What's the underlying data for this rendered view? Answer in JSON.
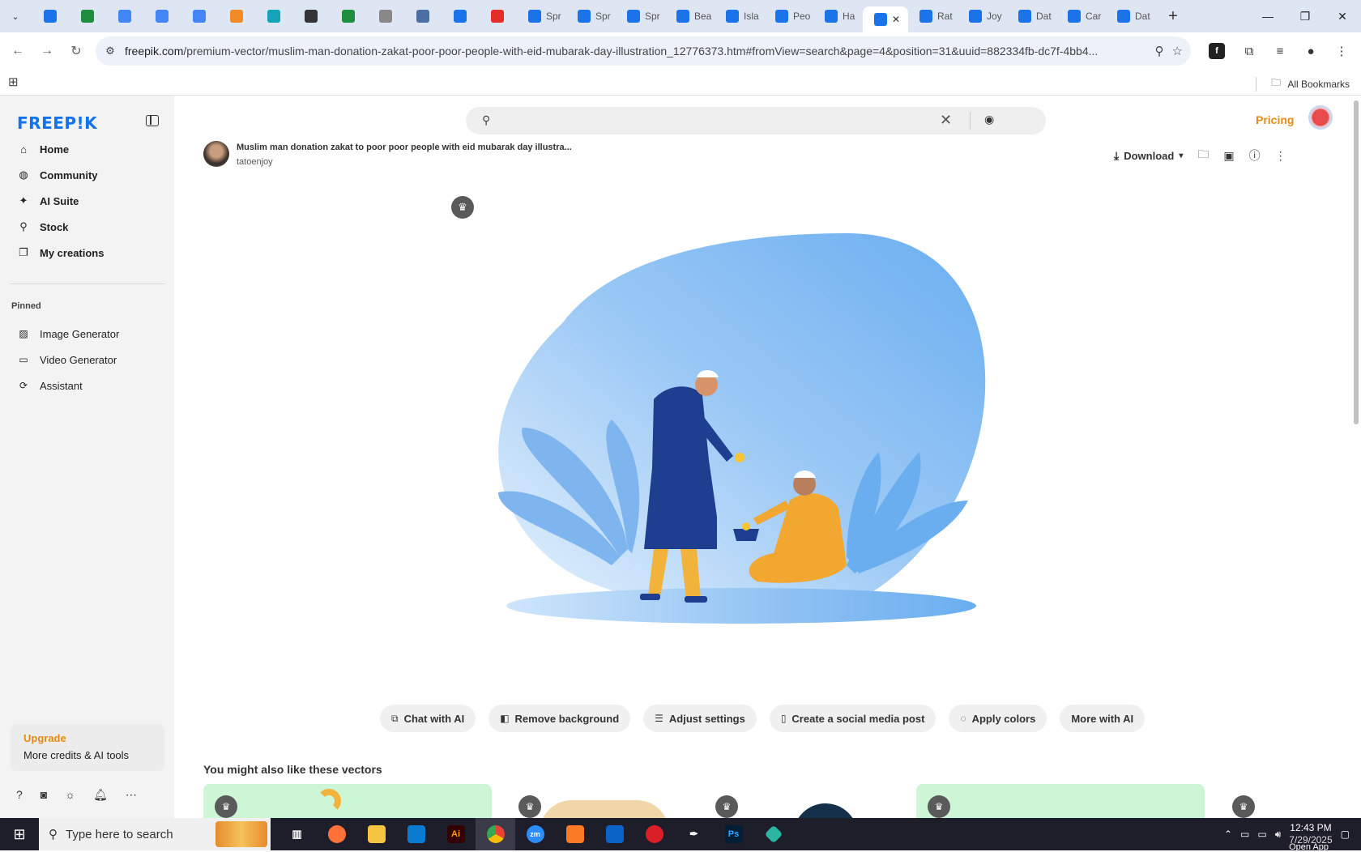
{
  "browser": {
    "tabs": [
      {
        "label": "",
        "color": "#1a73e8"
      },
      {
        "label": "",
        "color": "#1e8e3e"
      },
      {
        "label": "",
        "color": "#4285f4"
      },
      {
        "label": "",
        "color": "#4285f4"
      },
      {
        "label": "",
        "color": "#4285f4"
      },
      {
        "label": "",
        "color": "#f28b25"
      },
      {
        "label": "",
        "color": "#14a3b8"
      },
      {
        "label": "",
        "color": "#333333"
      },
      {
        "label": "",
        "color": "#1e8e3e"
      },
      {
        "label": "",
        "color": "#888888"
      },
      {
        "label": "",
        "color": "#4a6fa5"
      },
      {
        "label": "",
        "color": "#1a73e8"
      },
      {
        "label": "",
        "color": "#e52d27"
      },
      {
        "label": "Spr",
        "color": "#1a73e8"
      },
      {
        "label": "Spr",
        "color": "#1a73e8"
      },
      {
        "label": "Spr",
        "color": "#1a73e8"
      },
      {
        "label": "Bea",
        "color": "#1a73e8"
      },
      {
        "label": "Isla",
        "color": "#1a73e8"
      },
      {
        "label": "Peo",
        "color": "#1a73e8"
      },
      {
        "label": "Ha",
        "color": "#1a73e8"
      }
    ],
    "active_tab_close": "✕",
    "after_tabs": [
      {
        "label": "Rat",
        "color": "#1a73e8"
      },
      {
        "label": "Joy",
        "color": "#1a73e8"
      },
      {
        "label": "Dat",
        "color": "#1a73e8"
      },
      {
        "label": "Car",
        "color": "#1a73e8"
      },
      {
        "label": "Dat",
        "color": "#1a73e8"
      }
    ],
    "url_host": "freepik.com",
    "url_rest": "/premium-vector/muslim-man-donation-zakat-poor-poor-people-with-eid-mubarak-day-illustration_12776373.htm#fromView=search&page=4&position=31&uuid=882334fb-dc7f-4bb4...",
    "all_bookmarks": "All Bookmarks"
  },
  "sidebar": {
    "logo": "FREEP!K",
    "nav": [
      {
        "label": "Home",
        "icon": "⌂"
      },
      {
        "label": "Community",
        "icon": "◍"
      },
      {
        "label": "AI Suite",
        "icon": "✦"
      },
      {
        "label": "Stock",
        "icon": "⚲"
      },
      {
        "label": "My creations",
        "icon": "❐"
      }
    ],
    "pinned_label": "Pinned",
    "pinned": [
      {
        "label": "Image Generator",
        "icon": "▨"
      },
      {
        "label": "Video Generator",
        "icon": "▭"
      },
      {
        "label": "Assistant",
        "icon": "⟳"
      }
    ],
    "upgrade_title": "Upgrade",
    "upgrade_sub": "More credits & AI tools"
  },
  "main": {
    "search_placeholder": "",
    "pricing": "Pricing",
    "image_title": "Muslim man donation zakat to poor poor people with eid mubarak day illustra...",
    "author": "tatoenjoy",
    "download": "Download",
    "ai_buttons": [
      {
        "label": "Chat with AI",
        "icon": "⧉"
      },
      {
        "label": "Remove background",
        "icon": "◧"
      },
      {
        "label": "Adjust settings",
        "icon": "☰"
      },
      {
        "label": "Create a social media post",
        "icon": "▯"
      },
      {
        "label": "Apply colors",
        "icon": "◌"
      },
      {
        "label": "More with AI",
        "icon": ""
      }
    ],
    "also_title": "You might also like these vectors",
    "colors": {
      "accent": "#e38b14",
      "brand": "#1273eb",
      "blob": "#6aaef0"
    }
  },
  "taskbar": {
    "search_placeholder": "Type here to search",
    "time": "12:43 PM",
    "date": "7/29/2025",
    "open_app": "Open App"
  }
}
